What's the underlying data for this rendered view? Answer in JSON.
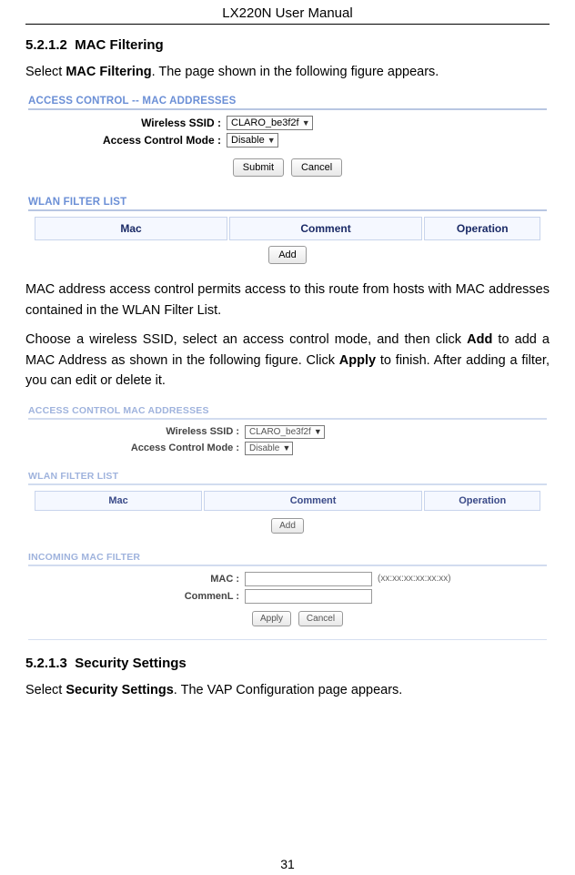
{
  "header": "LX220N User Manual",
  "page_number": "31",
  "sections": {
    "s1": {
      "num": "5.2.1.2",
      "title": "MAC Filtering"
    },
    "s2": {
      "num": "5.2.1.3",
      "title": "Security Settings"
    }
  },
  "paras": {
    "p1a": "Select ",
    "p1b": "MAC Filtering",
    "p1c": ". The page shown in the following figure appears.",
    "p2": "MAC address access control permits access to this route from hosts with MAC addresses contained in the WLAN Filter List.",
    "p3a": "Choose a wireless SSID, select an access control mode, and then click ",
    "p3b": "Add",
    "p3c": " to add a MAC Address as shown in the following figure. Click ",
    "p3d": "Apply",
    "p3e": " to finish. After adding a filter, you can edit or delete it.",
    "p4a": "Select ",
    "p4b": "Security Settings",
    "p4c": ". The VAP Configuration page appears."
  },
  "fig1": {
    "title": "ACCESS CONTROL -- MAC ADDRESSES",
    "wlan_label": "Wireless SSID :",
    "wlan_value": "CLARO_be3f2f",
    "acm_label": "Access Control Mode :",
    "acm_value": "Disable",
    "submit": "Submit",
    "cancel": "Cancel",
    "list_title": "WLAN FILTER LIST",
    "col_mac": "Mac",
    "col_comment": "Comment",
    "col_op": "Operation",
    "add": "Add"
  },
  "fig2": {
    "title": "ACCESS CONTROL    MAC ADDRESSES",
    "wlan_label": "Wireless SSID :",
    "wlan_value": "CLARO_be3f2f",
    "acm_label": "Access Control Mode :",
    "acm_value": "Disable",
    "list_title": "WLAN FILTER LIST",
    "col_mac": "Mac",
    "col_comment": "Comment",
    "col_op": "Operation",
    "add": "Add",
    "incoming_title": "INCOMING MAC FILTER",
    "mac_label": "MAC :",
    "mac_hint": "(xx:xx:xx:xx:xx:xx)",
    "comment_label": "CommenL :",
    "apply": "Apply",
    "cancel": "Cancel"
  }
}
